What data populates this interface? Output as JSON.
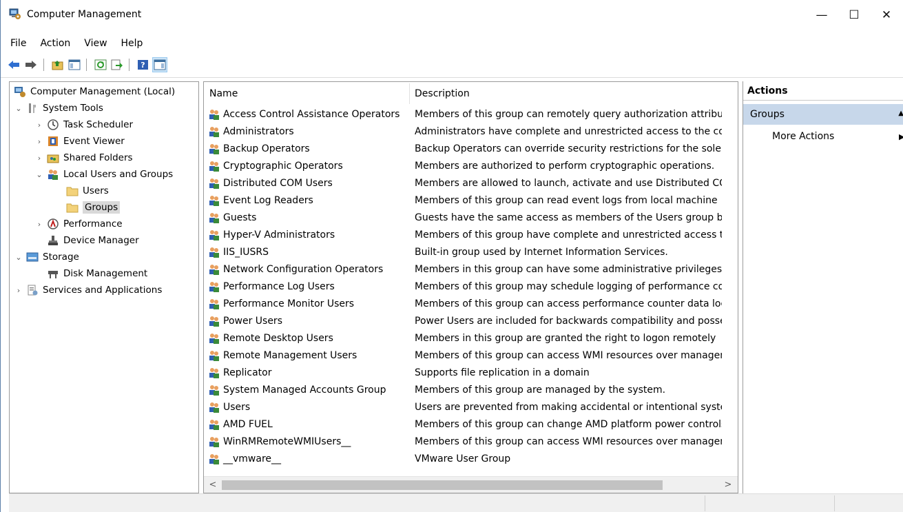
{
  "window": {
    "title": "Computer Management",
    "min": "—",
    "max": "☐",
    "close": "✕"
  },
  "menu": [
    "File",
    "Action",
    "View",
    "Help"
  ],
  "toolbar": [
    "back-arrow-icon",
    "forward-arrow-icon",
    "up-folder-icon",
    "show-hide-tree-icon",
    "refresh-icon",
    "export-list-icon",
    "help-icon",
    "show-hide-action-pane-icon"
  ],
  "tree": [
    {
      "label": "Computer Management (Local)",
      "indent": 0,
      "chev": "",
      "icon": "computer-management-icon"
    },
    {
      "label": "System Tools",
      "indent": 1,
      "chev": "⌄",
      "icon": "system-tools-icon"
    },
    {
      "label": "Task Scheduler",
      "indent": 2,
      "chev": "›",
      "icon": "clock-icon"
    },
    {
      "label": "Event Viewer",
      "indent": 2,
      "chev": "›",
      "icon": "event-viewer-icon"
    },
    {
      "label": "Shared Folders",
      "indent": 2,
      "chev": "›",
      "icon": "shared-folders-icon"
    },
    {
      "label": "Local Users and Groups",
      "indent": 2,
      "chev": "⌄",
      "icon": "users-icon"
    },
    {
      "label": "Users",
      "indent": 3,
      "chev": "",
      "icon": "folder-icon"
    },
    {
      "label": "Groups",
      "indent": 3,
      "chev": "",
      "icon": "folder-icon",
      "selected": true
    },
    {
      "label": "Performance",
      "indent": 2,
      "chev": "›",
      "icon": "performance-icon"
    },
    {
      "label": "Device Manager",
      "indent": 2,
      "chev": "",
      "icon": "device-manager-icon"
    },
    {
      "label": "Storage",
      "indent": 1,
      "chev": "⌄",
      "icon": "storage-icon"
    },
    {
      "label": "Disk Management",
      "indent": 2,
      "chev": "",
      "icon": "disk-management-icon"
    },
    {
      "label": "Services and Applications",
      "indent": 1,
      "chev": "›",
      "icon": "services-icon"
    }
  ],
  "list": {
    "headers": {
      "name": "Name",
      "description": "Description"
    },
    "rows": [
      {
        "name": "Access Control Assistance Operators",
        "description": "Members of this group can remotely query authorization attributes"
      },
      {
        "name": "Administrators",
        "description": "Administrators have complete and unrestricted access to the comp"
      },
      {
        "name": "Backup Operators",
        "description": "Backup Operators can override security restrictions for the sole purp"
      },
      {
        "name": "Cryptographic Operators",
        "description": "Members are authorized to perform cryptographic operations."
      },
      {
        "name": "Distributed COM Users",
        "description": "Members are allowed to launch, activate and use Distributed COM"
      },
      {
        "name": "Event Log Readers",
        "description": "Members of this group can read event logs from local machine"
      },
      {
        "name": "Guests",
        "description": "Guests have the same access as members of the Users group by def"
      },
      {
        "name": "Hyper-V Administrators",
        "description": "Members of this group have complete and unrestricted access to al"
      },
      {
        "name": "IIS_IUSRS",
        "description": "Built-in group used by Internet Information Services."
      },
      {
        "name": "Network Configuration Operators",
        "description": "Members in this group can have some administrative privileges to r"
      },
      {
        "name": "Performance Log Users",
        "description": "Members of this group may schedule logging of performance cour"
      },
      {
        "name": "Performance Monitor Users",
        "description": "Members of this group can access performance counter data locall"
      },
      {
        "name": "Power Users",
        "description": "Power Users are included for backwards compatibility and possess l"
      },
      {
        "name": "Remote Desktop Users",
        "description": "Members in this group are granted the right to logon remotely"
      },
      {
        "name": "Remote Management Users",
        "description": "Members of this group can access WMI resources over managemer"
      },
      {
        "name": "Replicator",
        "description": "Supports file replication in a domain"
      },
      {
        "name": "System Managed Accounts Group",
        "description": "Members of this group are managed by the system."
      },
      {
        "name": "Users",
        "description": "Users are prevented from making accidental or intentional system-"
      },
      {
        "name": "AMD FUEL",
        "description": "Members of this group can change AMD platform power controls v"
      },
      {
        "name": "WinRMRemoteWMIUsers__",
        "description": "Members of this group can access WMI resources over managemer"
      },
      {
        "name": "__vmware__",
        "description": "VMware User Group"
      }
    ]
  },
  "actions": {
    "header": "Actions",
    "group": "Groups",
    "more": "More Actions"
  },
  "colors": {
    "selection": "#d9d9d9",
    "actions_group": "#c7d7ea",
    "border": "#9a9a9a"
  }
}
